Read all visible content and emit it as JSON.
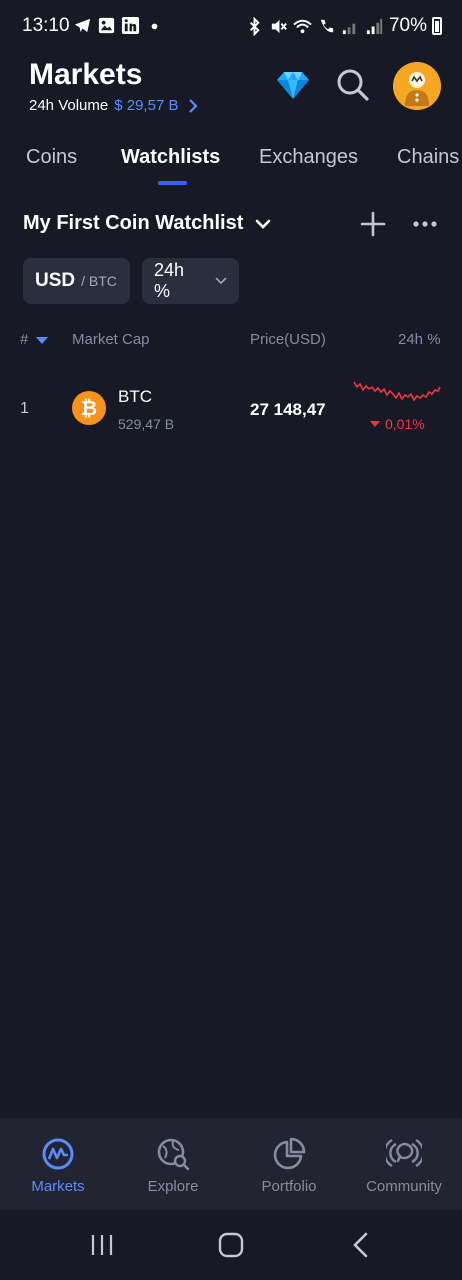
{
  "status_bar": {
    "time": "13:10",
    "battery": "70%"
  },
  "header": {
    "title": "Markets",
    "volume_label": "24h Volume",
    "volume_value": "$ 29,57 B"
  },
  "tabs": [
    {
      "label": "Coins"
    },
    {
      "label": "Watchlists"
    },
    {
      "label": "Exchanges"
    },
    {
      "label": "Chains"
    }
  ],
  "watchlist": {
    "name": "My First Coin Watchlist"
  },
  "filters": {
    "currency_primary": "USD",
    "currency_secondary": "/ BTC",
    "period": "24h %"
  },
  "columns": {
    "rank": "#",
    "market_cap": "Market Cap",
    "price": "Price(USD)",
    "change": "24h %"
  },
  "rows": [
    {
      "rank": "1",
      "symbol": "BTC",
      "market_cap": "529,47 B",
      "price": "27 148,47",
      "change": "0,01%",
      "trend": "down"
    }
  ],
  "bottom_nav": [
    {
      "label": "Markets",
      "icon": "markets-icon"
    },
    {
      "label": "Explore",
      "icon": "explore-icon"
    },
    {
      "label": "Portfolio",
      "icon": "portfolio-icon"
    },
    {
      "label": "Community",
      "icon": "community-icon"
    }
  ],
  "colors": {
    "background": "#171924",
    "accent": "#3861fb",
    "link": "#5b8cff",
    "negative": "#ea3943",
    "btc_orange": "#f7931a"
  }
}
